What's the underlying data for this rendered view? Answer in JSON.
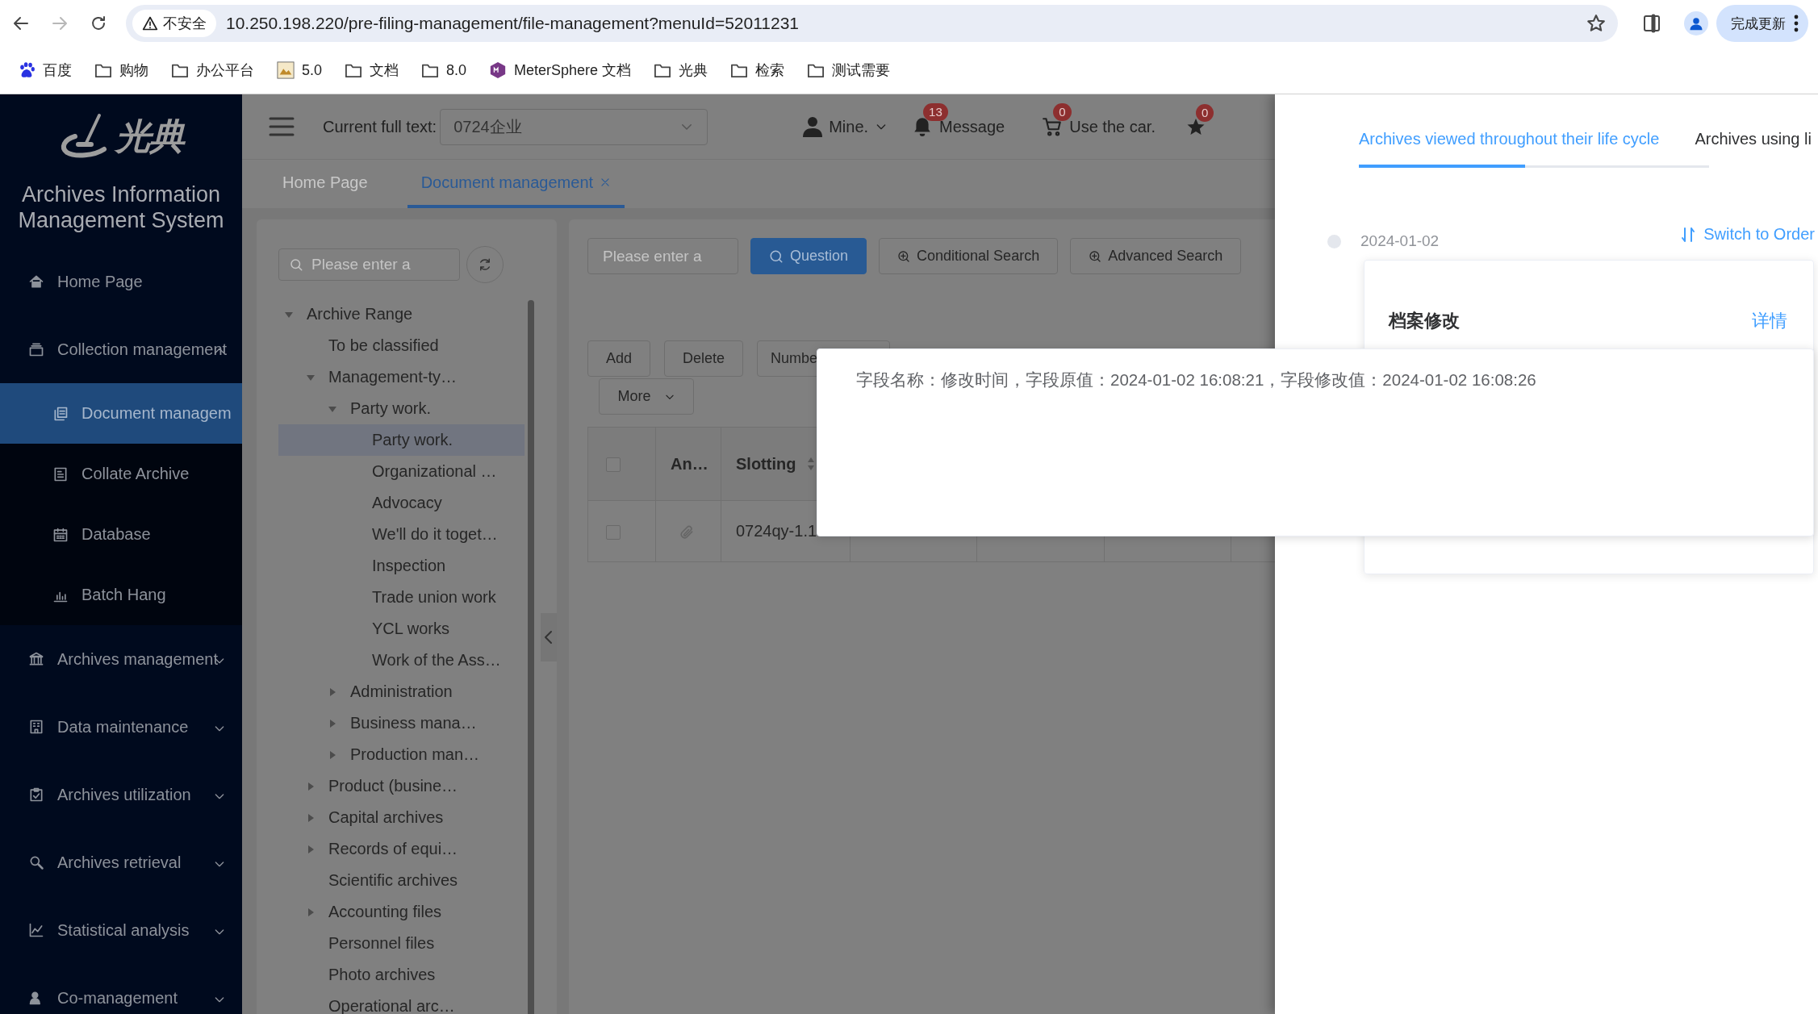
{
  "browser": {
    "security_label": "不安全",
    "url": "10.250.198.220/pre-filing-management/file-management?menuId=52011231",
    "update_button": "完成更新",
    "bookmarks": [
      {
        "kind": "baidu",
        "label": "百度"
      },
      {
        "kind": "folder",
        "label": "购物"
      },
      {
        "kind": "folder",
        "label": "办公平台"
      },
      {
        "kind": "image",
        "label": "5.0"
      },
      {
        "kind": "folder",
        "label": "文档"
      },
      {
        "kind": "folder",
        "label": "8.0"
      },
      {
        "kind": "metersphere",
        "label": "MeterSphere 文档"
      },
      {
        "kind": "folder",
        "label": "光典"
      },
      {
        "kind": "folder",
        "label": "检索"
      },
      {
        "kind": "folder",
        "label": "测试需要"
      }
    ]
  },
  "sidebar": {
    "logo_text": "光典",
    "title": "Archives Information Management System",
    "items": [
      {
        "label": "Home Page",
        "selected": false
      },
      {
        "label": "Collection management",
        "selected": false,
        "expanded": true,
        "children": [
          {
            "label": "Document managem",
            "selected": true
          },
          {
            "label": "Collate Archive",
            "selected": false
          },
          {
            "label": "Database",
            "selected": false
          },
          {
            "label": "Batch Hang",
            "selected": false
          }
        ]
      },
      {
        "label": "Archives management",
        "selected": false,
        "expanded": false
      },
      {
        "label": "Data maintenance",
        "selected": false,
        "expanded": false
      },
      {
        "label": "Archives utilization",
        "selected": false,
        "expanded": false
      },
      {
        "label": "Archives retrieval",
        "selected": false,
        "expanded": false
      },
      {
        "label": "Statistical analysis",
        "selected": false,
        "expanded": false
      },
      {
        "label": "Co-management",
        "selected": false,
        "expanded": false
      }
    ]
  },
  "header": {
    "scope_label": "Current full text:",
    "scope_value": "0724企业",
    "user": "Mine.",
    "message": {
      "label": "Message",
      "badge": "13"
    },
    "cart": {
      "label": "Use the car.",
      "badge": "0"
    },
    "favorites": {
      "badge": "0"
    },
    "tabs": [
      {
        "label": "Home Page",
        "selected": false,
        "closable": false
      },
      {
        "label": "Document management",
        "selected": true,
        "closable": true
      }
    ]
  },
  "tree_panel": {
    "search_placeholder": "Please enter a",
    "tree": [
      {
        "label": "Archive Range",
        "selected": false,
        "expanded": true,
        "children": [
          {
            "label": "To be classified",
            "selected": false
          },
          {
            "label": "Management-ty…",
            "selected": false,
            "expanded": true,
            "children": [
              {
                "label": "Party work.",
                "selected": false,
                "expanded": true,
                "children": [
                  {
                    "label": "Party work.",
                    "selected": true
                  },
                  {
                    "label": "Organizational …",
                    "selected": false
                  },
                  {
                    "label": "Advocacy",
                    "selected": false
                  },
                  {
                    "label": "We'll do it toget…",
                    "selected": false
                  },
                  {
                    "label": "Inspection",
                    "selected": false
                  },
                  {
                    "label": "Trade union work",
                    "selected": false
                  },
                  {
                    "label": "YCL works",
                    "selected": false
                  },
                  {
                    "label": "Work of the Ass…",
                    "selected": false
                  }
                ]
              },
              {
                "label": "Administration",
                "selected": false,
                "expanded": false
              },
              {
                "label": "Business mana…",
                "selected": false,
                "expanded": false
              },
              {
                "label": "Production man…",
                "selected": false,
                "expanded": false
              }
            ]
          },
          {
            "label": "Product (busine…",
            "selected": false,
            "expanded": false
          },
          {
            "label": "Capital archives",
            "selected": false,
            "expanded": false
          },
          {
            "label": "Records of equi…",
            "selected": false,
            "expanded": false
          },
          {
            "label": "Scientific archives",
            "selected": false
          },
          {
            "label": "Accounting files",
            "selected": false,
            "expanded": false
          },
          {
            "label": "Personnel files",
            "selected": false
          },
          {
            "label": "Photo archives",
            "selected": false
          },
          {
            "label": "Operational arc…",
            "selected": false
          }
        ]
      }
    ]
  },
  "content": {
    "search_placeholder": "Please enter a",
    "search_buttons": [
      {
        "kind": "primary",
        "label": "Question"
      },
      {
        "kind": "plus",
        "label": "Conditional Search"
      },
      {
        "kind": "plus",
        "label": "Advanced Search"
      }
    ],
    "actions": [
      "Add",
      "Delete",
      "Numbe"
    ],
    "more_button": "More",
    "table": {
      "all_checked": false,
      "columns": [
        {
          "label": "An…"
        },
        {
          "label": "Slotting",
          "sortable": true
        }
      ],
      "rows": [
        {
          "checked": false,
          "attachment": true,
          "cells": [
            "",
            "0724qy-1.1"
          ]
        }
      ]
    }
  },
  "drawer": {
    "tabs": [
      {
        "label": "Archives viewed throughout their life cycle",
        "selected": true
      },
      {
        "label": "Archives using li",
        "selected": false
      }
    ],
    "switch_link": "Switch to Order",
    "timeline": [
      {
        "date": "2024-01-02",
        "title": "档案修改",
        "link": "详情"
      }
    ]
  },
  "popup": {
    "text": "字段名称：修改时间，字段原值：2024-01-02 16:08:21，字段修改值：2024-01-02 16:08:26"
  }
}
